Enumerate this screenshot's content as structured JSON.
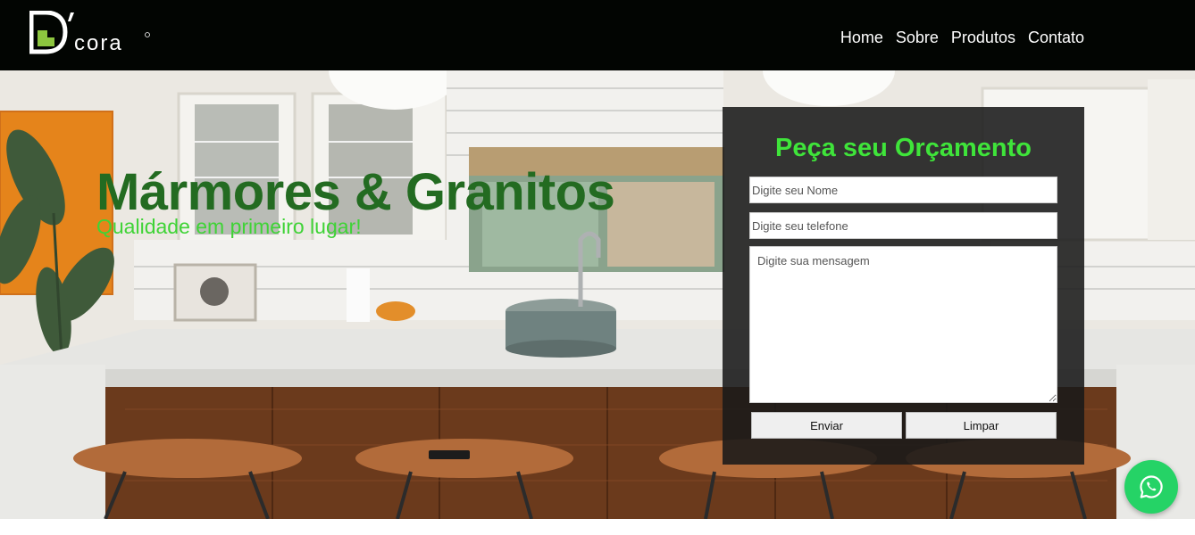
{
  "brand": {
    "logo_text": "D'cora",
    "accent": "#8dc63f"
  },
  "nav": {
    "items": [
      "Home",
      "Sobre",
      "Produtos",
      "Contato"
    ]
  },
  "hero": {
    "title": "Mármores & Granitos",
    "subtitle": "Qualidade em primeiro lugar!",
    "title_color": "#236b21",
    "subtitle_color": "#3fd336"
  },
  "quote_form": {
    "title": "Peça seu Orçamento",
    "title_color": "#3fe43a",
    "name_placeholder": "Digite seu Nome",
    "phone_placeholder": "Digite seu telefone",
    "message_placeholder": "Digite sua mensagem",
    "send_label": "Enviar",
    "clear_label": "Limpar"
  },
  "whatsapp": {
    "icon": "whatsapp-icon",
    "color": "#25d366"
  }
}
